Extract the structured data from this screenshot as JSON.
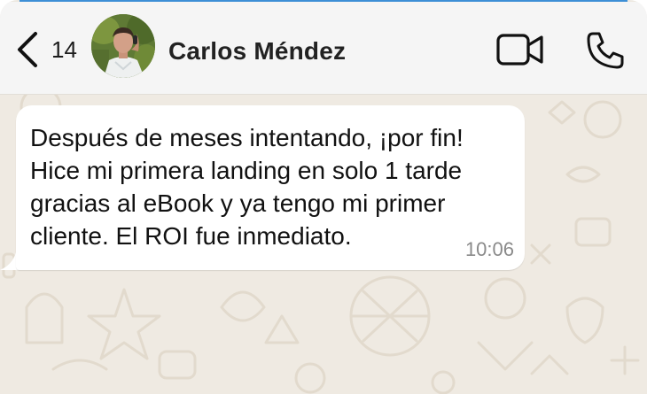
{
  "header": {
    "back_count": "14",
    "contact_name": "Carlos Méndez"
  },
  "message": {
    "text": "Después de meses intentando, ¡por fin!\nHice mi primera landing en solo 1 tarde\ngracias al eBook y ya tengo mi primer\ncliente. El ROI fue inmediato.",
    "time": "10:06"
  },
  "icons": {
    "back": "chevron-left-icon",
    "video": "video-camera-icon",
    "call": "phone-icon"
  },
  "colors": {
    "header_bg": "#f5f5f5",
    "chat_bg": "#efeae2",
    "bubble_bg": "#ffffff",
    "accent": "#3d8fd6",
    "time_text": "#8a8a8a"
  }
}
